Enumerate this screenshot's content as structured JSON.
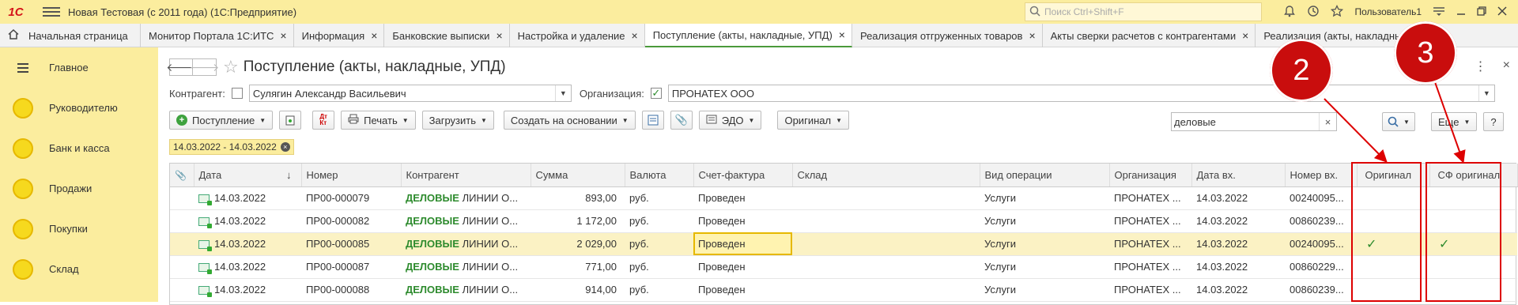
{
  "window": {
    "logo": "1С",
    "title": "Новая Тестовая (с 2011 года)  (1С:Предприятие)",
    "search_placeholder": "Поиск Ctrl+Shift+F",
    "user": "Пользователь1"
  },
  "tabs": [
    {
      "label": "Начальная страница",
      "closable": false
    },
    {
      "label": "Монитор Портала 1С:ИТС",
      "closable": true
    },
    {
      "label": "Информация",
      "closable": true
    },
    {
      "label": "Банковские выписки",
      "closable": true
    },
    {
      "label": "Настройка и удаление",
      "closable": true
    },
    {
      "label": "Поступление (акты, накладные, УПД)",
      "closable": true,
      "active": true
    },
    {
      "label": "Реализация отгруженных товаров",
      "closable": true
    },
    {
      "label": "Акты сверки расчетов с контрагентами",
      "closable": true
    },
    {
      "label": "Реализация (акты, накладные, УПД)",
      "closable": true
    }
  ],
  "sidebar": {
    "items": [
      {
        "label": "Главное",
        "icon": "menu-lines-icon"
      },
      {
        "label": "Руководителю",
        "icon": "circle-icon"
      },
      {
        "label": "Банк и касса",
        "icon": "circle-icon"
      },
      {
        "label": "Продажи",
        "icon": "circle-icon"
      },
      {
        "label": "Покупки",
        "icon": "circle-icon"
      },
      {
        "label": "Склад",
        "icon": "circle-icon"
      }
    ]
  },
  "form": {
    "title": "Поступление (акты, накладные, УПД)",
    "contractor_label": "Контрагент:",
    "contractor_value": "Сулягин Александр Васильевич",
    "contractor_checked": false,
    "org_label": "Организация:",
    "org_value": "ПРОНАТЕХ ООО",
    "org_checked": true
  },
  "toolbar": {
    "receipt": "Поступление",
    "print": "Печать",
    "load": "Загрузить",
    "create_based": "Создать на основании",
    "edo": "ЭДО",
    "original": "Оригинал",
    "search_value": "деловые",
    "more": "Еще",
    "help": "?"
  },
  "filter": {
    "period": "14.03.2022 - 14.03.2022"
  },
  "table": {
    "headers": [
      "Дата",
      "Номер",
      "Контрагент",
      "Сумма",
      "Валюта",
      "Счет-фактура",
      "Склад",
      "Вид операции",
      "Организация",
      "Дата вх.",
      "Номер вх.",
      "Оригинал",
      "СФ оригинал"
    ],
    "rows": [
      {
        "date": "14.03.2022",
        "number": "ПР00-000079",
        "kw": "ДЕЛОВЫЕ",
        "contr": " ЛИНИИ О...",
        "sum": "893,00",
        "cur": "руб.",
        "sf": "Проведен",
        "store": "",
        "op": "Услуги",
        "org": "ПРОНАТЕХ ...",
        "date_in": "14.03.2022",
        "num_in": "00240095...",
        "original": false,
        "sf_original": false
      },
      {
        "date": "14.03.2022",
        "number": "ПР00-000082",
        "kw": "ДЕЛОВЫЕ",
        "contr": " ЛИНИИ О...",
        "sum": "1 172,00",
        "cur": "руб.",
        "sf": "Проведен",
        "store": "",
        "op": "Услуги",
        "org": "ПРОНАТЕХ ...",
        "date_in": "14.03.2022",
        "num_in": "00860239...",
        "original": false,
        "sf_original": false
      },
      {
        "date": "14.03.2022",
        "number": "ПР00-000085",
        "kw": "ДЕЛОВЫЕ",
        "contr": " ЛИНИИ О...",
        "sum": "2 029,00",
        "cur": "руб.",
        "sf": "Проведен",
        "store": "",
        "op": "Услуги",
        "org": "ПРОНАТЕХ ...",
        "date_in": "14.03.2022",
        "num_in": "00240095...",
        "original": true,
        "sf_original": true,
        "selected": true
      },
      {
        "date": "14.03.2022",
        "number": "ПР00-000087",
        "kw": "ДЕЛОВЫЕ",
        "contr": " ЛИНИИ О...",
        "sum": "771,00",
        "cur": "руб.",
        "sf": "Проведен",
        "store": "",
        "op": "Услуги",
        "org": "ПРОНАТЕХ ...",
        "date_in": "14.03.2022",
        "num_in": "00860229...",
        "original": false,
        "sf_original": false
      },
      {
        "date": "14.03.2022",
        "number": "ПР00-000088",
        "kw": "ДЕЛОВЫЕ",
        "contr": " ЛИНИИ О...",
        "sum": "914,00",
        "cur": "руб.",
        "sf": "Проведен",
        "store": "",
        "op": "Услуги",
        "org": "ПРОНАТЕХ ...",
        "date_in": "14.03.2022",
        "num_in": "00860239...",
        "original": false,
        "sf_original": false
      }
    ]
  },
  "annotations": {
    "marker_2": "2",
    "marker_3": "3",
    "color": "#d00000"
  },
  "check_glyph": "✓"
}
